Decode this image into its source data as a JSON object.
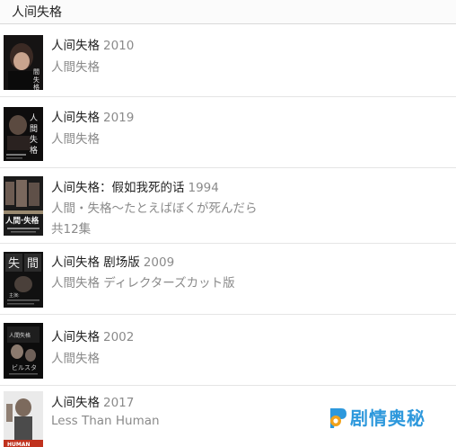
{
  "header": {
    "title": "人间失格"
  },
  "items": [
    {
      "title": "人间失格",
      "year": "2010",
      "alt_title": "人間失格"
    },
    {
      "title": "人间失格",
      "year": "2019",
      "alt_title": "人間失格"
    },
    {
      "title": "人间失格：假如我死的话",
      "year": "1994",
      "alt_title": "人間・失格〜たとえばぼくが死んだら",
      "episodes": "共12集"
    },
    {
      "title": "人间失格 剧场版",
      "year": "2009",
      "alt_title": "人間失格 ディレクターズカット版"
    },
    {
      "title": "人间失格",
      "year": "2002",
      "alt_title": "人間失格"
    },
    {
      "title": "人间失格",
      "year": "2017",
      "alt_title": "Less Than Human"
    }
  ],
  "watermark": {
    "text": "剧情奥秘"
  },
  "colors": {
    "accent": "#2d98dc"
  }
}
